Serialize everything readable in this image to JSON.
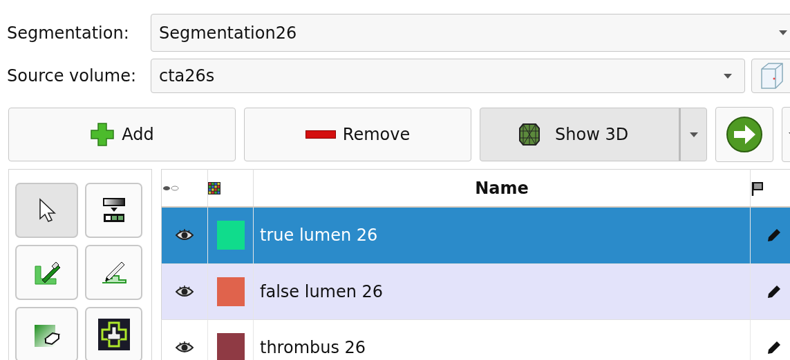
{
  "segmentation": {
    "label": "Segmentation:",
    "value": "Segmentation26"
  },
  "source_volume": {
    "label": "Source volume:",
    "value": "cta26s"
  },
  "actions": [
    {
      "kind": "add",
      "label": "Add"
    },
    {
      "kind": "remove",
      "label": "Remove"
    },
    {
      "kind": "show3d",
      "label": "Show 3D",
      "checked": true
    }
  ],
  "tools": [
    {
      "kind": "select",
      "selected": true
    },
    {
      "kind": "threshold",
      "selected": false
    },
    {
      "kind": "paint",
      "selected": false
    },
    {
      "kind": "draw",
      "selected": false
    },
    {
      "kind": "erase",
      "selected": false
    },
    {
      "kind": "grow",
      "selected": false
    }
  ],
  "table": {
    "columns": [
      {
        "kind": "visibility"
      },
      {
        "kind": "color"
      },
      {
        "kind": "name",
        "label": "Name"
      },
      {
        "kind": "status"
      }
    ],
    "rows": [
      {
        "name": "true lumen 26",
        "color": "#10dc8c",
        "visible": true,
        "selected": true
      },
      {
        "name": "false lumen 26",
        "color": "#e0634c",
        "visible": true,
        "selected": false
      },
      {
        "name": "thrombus 26",
        "color": "#8f3a44",
        "visible": true,
        "selected": false
      }
    ]
  }
}
